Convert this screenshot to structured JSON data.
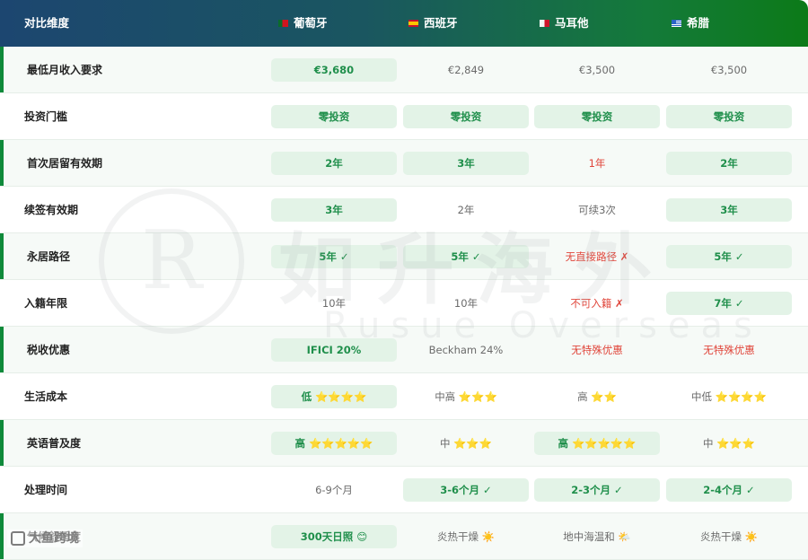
{
  "header": {
    "col0": "对比维度",
    "countries": [
      {
        "name": "葡萄牙",
        "flag": "portugal-flag"
      },
      {
        "name": "西班牙",
        "flag": "spain-flag"
      },
      {
        "name": "马耳他",
        "flag": "malta-flag"
      },
      {
        "name": "希腊",
        "flag": "greece-flag"
      }
    ]
  },
  "rows": [
    {
      "label": "最低月收入要求",
      "cells": [
        {
          "text": "€3,680",
          "style": "hl"
        },
        {
          "text": "€2,849",
          "style": "plain"
        },
        {
          "text": "€3,500",
          "style": "plain"
        },
        {
          "text": "€3,500",
          "style": "plain"
        }
      ]
    },
    {
      "label": "投资门槛",
      "cells": [
        {
          "text": "零投资",
          "style": "hl"
        },
        {
          "text": "零投资",
          "style": "hl"
        },
        {
          "text": "零投资",
          "style": "hl"
        },
        {
          "text": "零投资",
          "style": "hl"
        }
      ]
    },
    {
      "label": "首次居留有效期",
      "cells": [
        {
          "text": "2年",
          "style": "hl"
        },
        {
          "text": "3年",
          "style": "hl"
        },
        {
          "text": "1年",
          "style": "red"
        },
        {
          "text": "2年",
          "style": "hl"
        }
      ]
    },
    {
      "label": "续签有效期",
      "cells": [
        {
          "text": "3年",
          "style": "hl"
        },
        {
          "text": "2年",
          "style": "plain"
        },
        {
          "text": "可续3次",
          "style": "plain"
        },
        {
          "text": "3年",
          "style": "hl"
        }
      ]
    },
    {
      "label": "永居路径",
      "cells": [
        {
          "text": "5年 ✓",
          "style": "hl"
        },
        {
          "text": "5年 ✓",
          "style": "hl"
        },
        {
          "text": "无直接路径 ✗",
          "style": "red"
        },
        {
          "text": "5年 ✓",
          "style": "hl"
        }
      ]
    },
    {
      "label": "入籍年限",
      "cells": [
        {
          "text": "10年",
          "style": "plain"
        },
        {
          "text": "10年",
          "style": "plain"
        },
        {
          "text": "不可入籍 ✗",
          "style": "red"
        },
        {
          "text": "7年 ✓",
          "style": "hl"
        }
      ]
    },
    {
      "label": "税收优惠",
      "cells": [
        {
          "text": "IFICI 20%",
          "style": "hl"
        },
        {
          "text": "Beckham 24%",
          "style": "plain"
        },
        {
          "text": "无特殊优惠",
          "style": "red"
        },
        {
          "text": "无特殊优惠",
          "style": "red"
        }
      ]
    },
    {
      "label": "生活成本",
      "cells": [
        {
          "text": "低 ⭐⭐⭐⭐",
          "style": "hl"
        },
        {
          "text": "中高 ⭐⭐⭐",
          "style": "plain"
        },
        {
          "text": "高 ⭐⭐",
          "style": "plain"
        },
        {
          "text": "中低 ⭐⭐⭐⭐",
          "style": "plain"
        }
      ]
    },
    {
      "label": "英语普及度",
      "cells": [
        {
          "text": "高 ⭐⭐⭐⭐⭐",
          "style": "hl"
        },
        {
          "text": "中 ⭐⭐⭐",
          "style": "plain"
        },
        {
          "text": "高 ⭐⭐⭐⭐⭐",
          "style": "hl"
        },
        {
          "text": "中 ⭐⭐⭐",
          "style": "plain"
        }
      ]
    },
    {
      "label": "处理时间",
      "cells": [
        {
          "text": "6-9个月",
          "style": "plain"
        },
        {
          "text": "3-6个月 ✓",
          "style": "hl"
        },
        {
          "text": "2-3个月 ✓",
          "style": "hl"
        },
        {
          "text": "2-4个月 ✓",
          "style": "hl"
        }
      ]
    },
    {
      "label": "气候舒适度",
      "cells": [
        {
          "text": "300天日照 😊",
          "style": "hl"
        },
        {
          "text": "炎热干燥 ☀️",
          "style": "plain"
        },
        {
          "text": "地中海温和 🌤️",
          "style": "plain"
        },
        {
          "text": "炎热干燥 ☀️",
          "style": "plain"
        }
      ]
    }
  ],
  "watermark": {
    "cn": "如升海外",
    "en": "Rusue Overseas",
    "logo_letter": "R"
  },
  "corner_watermark": "大鱼跨境",
  "colors": {
    "accent_green": "#1f8f4b",
    "negative_red": "#e0453a",
    "header_start": "#1c4670",
    "header_end": "#0c7a18"
  }
}
